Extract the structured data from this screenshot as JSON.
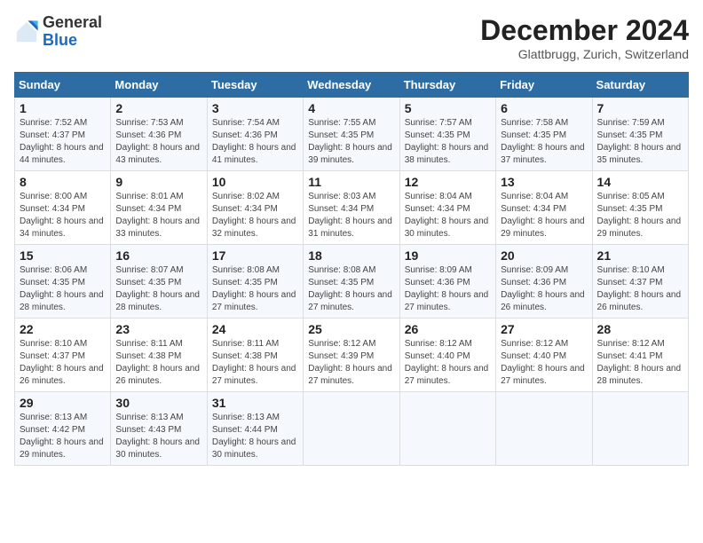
{
  "header": {
    "logo_general": "General",
    "logo_blue": "Blue",
    "main_title": "December 2024",
    "subtitle": "Glattbrugg, Zurich, Switzerland"
  },
  "days_of_week": [
    "Sunday",
    "Monday",
    "Tuesday",
    "Wednesday",
    "Thursday",
    "Friday",
    "Saturday"
  ],
  "weeks": [
    [
      {
        "day": "1",
        "sunrise": "7:52 AM",
        "sunset": "4:37 PM",
        "daylight": "8 hours and 44 minutes."
      },
      {
        "day": "2",
        "sunrise": "7:53 AM",
        "sunset": "4:36 PM",
        "daylight": "8 hours and 43 minutes."
      },
      {
        "day": "3",
        "sunrise": "7:54 AM",
        "sunset": "4:36 PM",
        "daylight": "8 hours and 41 minutes."
      },
      {
        "day": "4",
        "sunrise": "7:55 AM",
        "sunset": "4:35 PM",
        "daylight": "8 hours and 39 minutes."
      },
      {
        "day": "5",
        "sunrise": "7:57 AM",
        "sunset": "4:35 PM",
        "daylight": "8 hours and 38 minutes."
      },
      {
        "day": "6",
        "sunrise": "7:58 AM",
        "sunset": "4:35 PM",
        "daylight": "8 hours and 37 minutes."
      },
      {
        "day": "7",
        "sunrise": "7:59 AM",
        "sunset": "4:35 PM",
        "daylight": "8 hours and 35 minutes."
      }
    ],
    [
      {
        "day": "8",
        "sunrise": "8:00 AM",
        "sunset": "4:34 PM",
        "daylight": "8 hours and 34 minutes."
      },
      {
        "day": "9",
        "sunrise": "8:01 AM",
        "sunset": "4:34 PM",
        "daylight": "8 hours and 33 minutes."
      },
      {
        "day": "10",
        "sunrise": "8:02 AM",
        "sunset": "4:34 PM",
        "daylight": "8 hours and 32 minutes."
      },
      {
        "day": "11",
        "sunrise": "8:03 AM",
        "sunset": "4:34 PM",
        "daylight": "8 hours and 31 minutes."
      },
      {
        "day": "12",
        "sunrise": "8:04 AM",
        "sunset": "4:34 PM",
        "daylight": "8 hours and 30 minutes."
      },
      {
        "day": "13",
        "sunrise": "8:04 AM",
        "sunset": "4:34 PM",
        "daylight": "8 hours and 29 minutes."
      },
      {
        "day": "14",
        "sunrise": "8:05 AM",
        "sunset": "4:35 PM",
        "daylight": "8 hours and 29 minutes."
      }
    ],
    [
      {
        "day": "15",
        "sunrise": "8:06 AM",
        "sunset": "4:35 PM",
        "daylight": "8 hours and 28 minutes."
      },
      {
        "day": "16",
        "sunrise": "8:07 AM",
        "sunset": "4:35 PM",
        "daylight": "8 hours and 28 minutes."
      },
      {
        "day": "17",
        "sunrise": "8:08 AM",
        "sunset": "4:35 PM",
        "daylight": "8 hours and 27 minutes."
      },
      {
        "day": "18",
        "sunrise": "8:08 AM",
        "sunset": "4:35 PM",
        "daylight": "8 hours and 27 minutes."
      },
      {
        "day": "19",
        "sunrise": "8:09 AM",
        "sunset": "4:36 PM",
        "daylight": "8 hours and 27 minutes."
      },
      {
        "day": "20",
        "sunrise": "8:09 AM",
        "sunset": "4:36 PM",
        "daylight": "8 hours and 26 minutes."
      },
      {
        "day": "21",
        "sunrise": "8:10 AM",
        "sunset": "4:37 PM",
        "daylight": "8 hours and 26 minutes."
      }
    ],
    [
      {
        "day": "22",
        "sunrise": "8:10 AM",
        "sunset": "4:37 PM",
        "daylight": "8 hours and 26 minutes."
      },
      {
        "day": "23",
        "sunrise": "8:11 AM",
        "sunset": "4:38 PM",
        "daylight": "8 hours and 26 minutes."
      },
      {
        "day": "24",
        "sunrise": "8:11 AM",
        "sunset": "4:38 PM",
        "daylight": "8 hours and 27 minutes."
      },
      {
        "day": "25",
        "sunrise": "8:12 AM",
        "sunset": "4:39 PM",
        "daylight": "8 hours and 27 minutes."
      },
      {
        "day": "26",
        "sunrise": "8:12 AM",
        "sunset": "4:40 PM",
        "daylight": "8 hours and 27 minutes."
      },
      {
        "day": "27",
        "sunrise": "8:12 AM",
        "sunset": "4:40 PM",
        "daylight": "8 hours and 27 minutes."
      },
      {
        "day": "28",
        "sunrise": "8:12 AM",
        "sunset": "4:41 PM",
        "daylight": "8 hours and 28 minutes."
      }
    ],
    [
      {
        "day": "29",
        "sunrise": "8:13 AM",
        "sunset": "4:42 PM",
        "daylight": "8 hours and 29 minutes."
      },
      {
        "day": "30",
        "sunrise": "8:13 AM",
        "sunset": "4:43 PM",
        "daylight": "8 hours and 30 minutes."
      },
      {
        "day": "31",
        "sunrise": "8:13 AM",
        "sunset": "4:44 PM",
        "daylight": "8 hours and 30 minutes."
      },
      null,
      null,
      null,
      null
    ]
  ],
  "labels": {
    "sunrise": "Sunrise:",
    "sunset": "Sunset:",
    "daylight": "Daylight:"
  }
}
